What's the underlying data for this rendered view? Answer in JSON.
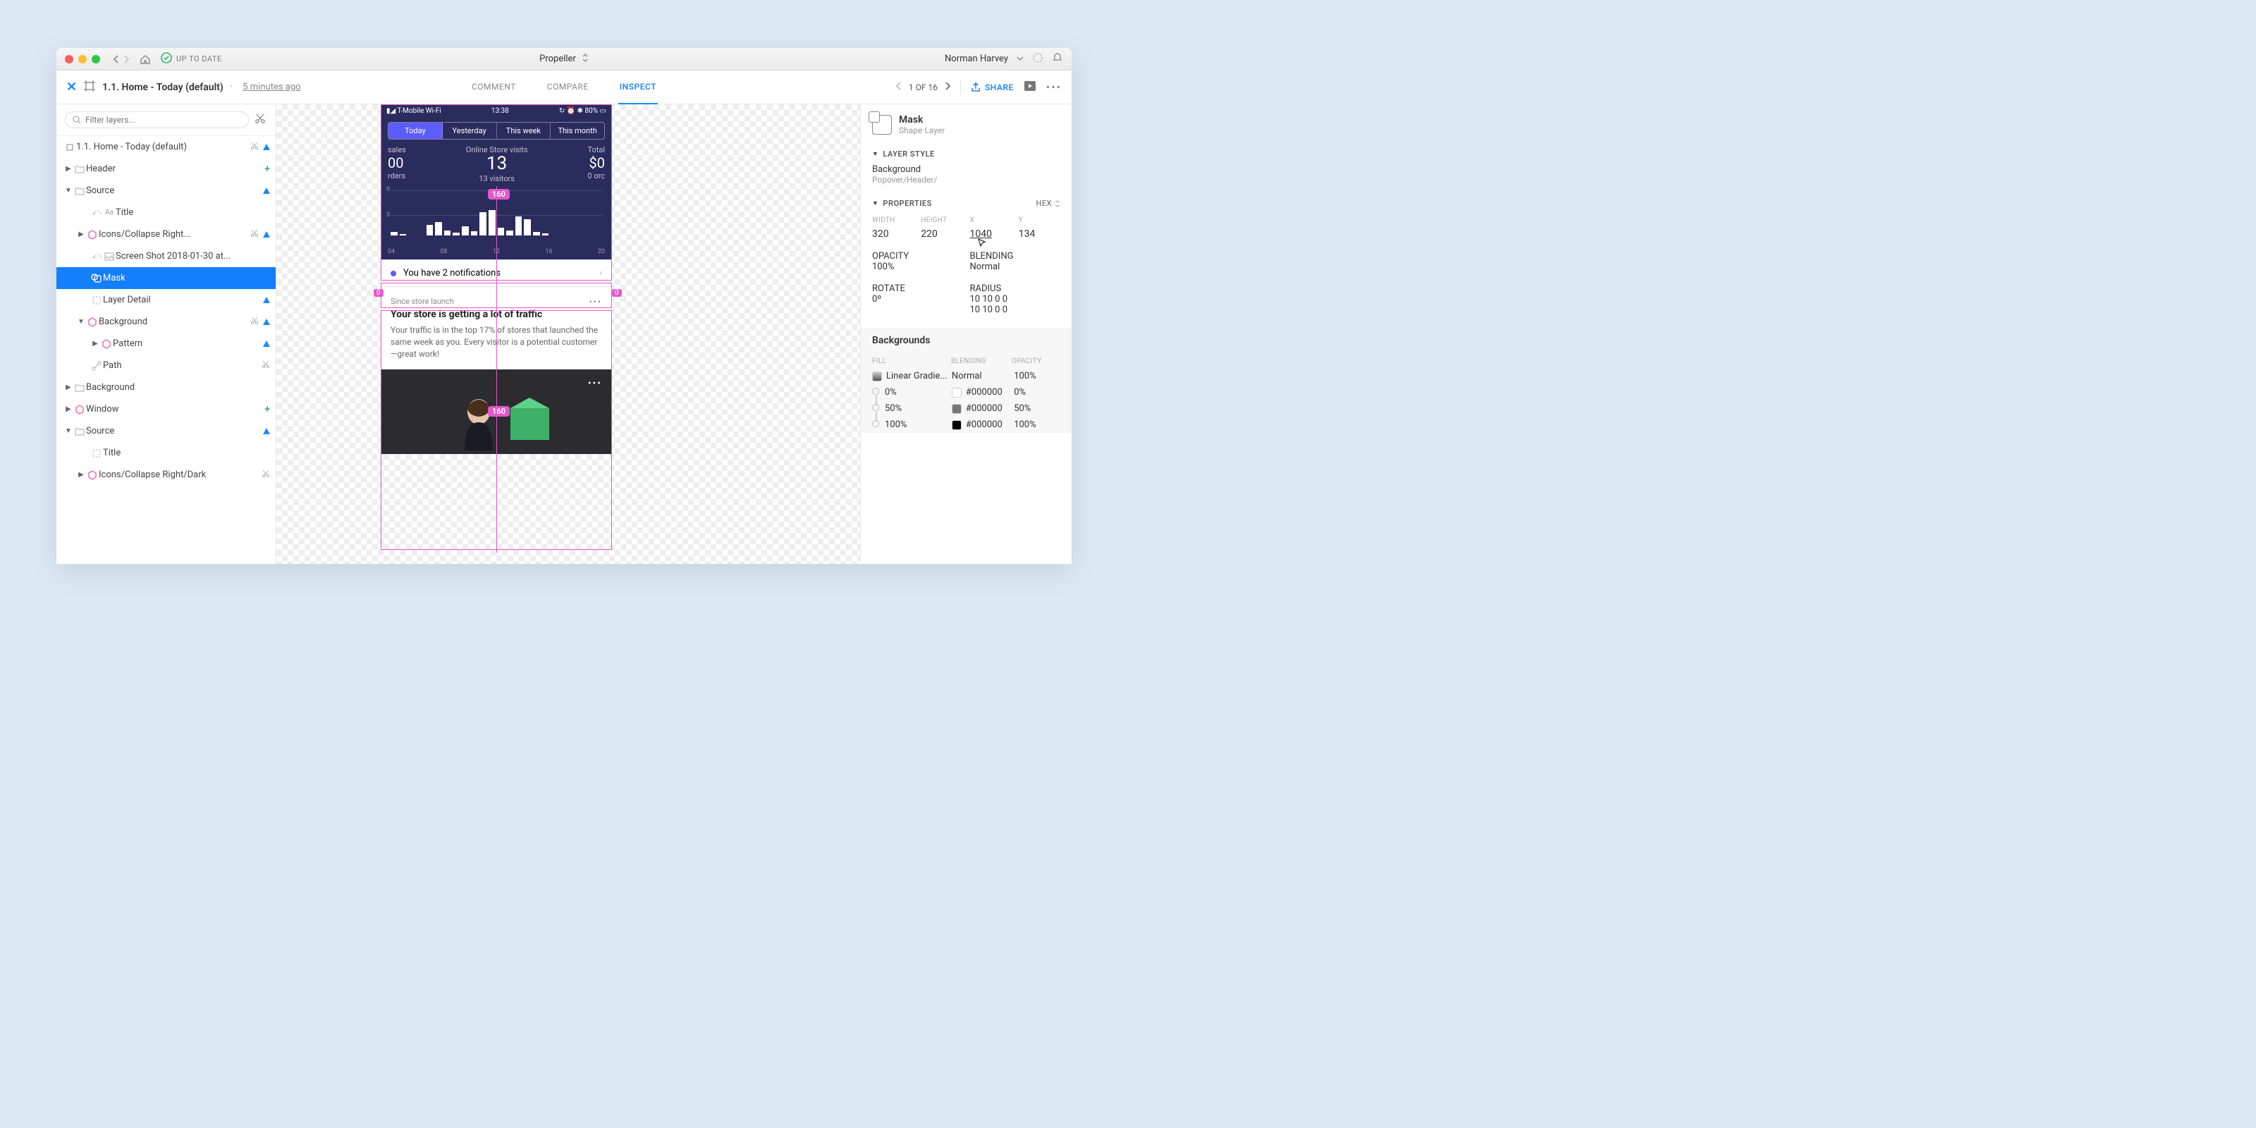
{
  "titlebar": {
    "status": "UP TO DATE",
    "project": "Propeller",
    "user": "Norman Harvey"
  },
  "toolbar": {
    "title": "1.1. Home - Today (default)",
    "time": "5 minutes ago",
    "tabs": {
      "comment": "COMMENT",
      "compare": "COMPARE",
      "inspect": "INSPECT"
    },
    "pager": "1 OF 16",
    "share": "SHARE"
  },
  "search": {
    "placeholder": "Filter layers..."
  },
  "tree": {
    "root": "1.1. Home - Today (default)",
    "header": "Header",
    "source": "Source",
    "title": "Title",
    "icons_collapse": "Icons/Collapse Right...",
    "screenshot": "Screen Shot 2018-01-30 at...",
    "mask": "Mask",
    "layer_detail": "Layer Detail",
    "background": "Background",
    "pattern": "Pattern",
    "path": "Path",
    "background2": "Background",
    "window": "Window",
    "source2": "Source",
    "title2": "Title",
    "icons_collapse2": "Icons/Collapse Right/Dark"
  },
  "phone": {
    "carrier": "T-Mobile Wi-Fi",
    "clock": "13:38",
    "battery": "80%",
    "seg": [
      "Today",
      "Yesterday",
      "This week",
      "This month"
    ],
    "left_metric_label": "sales",
    "left_metric_value": "00",
    "left_metric_sub": "rders",
    "center_label": "Online Store visits",
    "center_value": "13",
    "center_sub": "13 visitors",
    "right_label": "Total",
    "right_value": "$0",
    "right_sub": "0 orc",
    "ticks": [
      "04",
      "08",
      "12",
      "16",
      "20"
    ],
    "y9": "9",
    "y3": "3",
    "notif": "You have 2 notifications",
    "card_since": "Since store launch",
    "card_title": "Your store is getting a lot of traffic",
    "card_body": "Your traffic is in the top 17% of stores that launched the same week as you. Every visitor is a potential customer—great work!"
  },
  "measurements": {
    "w160a": "160",
    "w160b": "160",
    "zero": "0"
  },
  "right": {
    "name": "Mask",
    "type": "Shape Layer",
    "layerstyle_h": "LAYER STYLE",
    "ls_name": "Background",
    "ls_path": "Popover/Header/",
    "properties_h": "PROPERTIES",
    "hex": "HEX",
    "width_l": "WIDTH",
    "width_v": "320",
    "height_l": "HEIGHT",
    "height_v": "220",
    "x_l": "X",
    "x_v": "1040",
    "y_l": "Y",
    "y_v": "134",
    "opacity_l": "OPACITY",
    "opacity_v": "100%",
    "blending_l": "BLENDING",
    "blending_v": "Normal",
    "rotate_l": "ROTATE",
    "rotate_v": "0º",
    "radius_l": "RADIUS",
    "radius_old": "10 10 0 0",
    "radius_new": "10 10 0 0",
    "bg_h": "Backgrounds",
    "fill_l": "FILL",
    "blend_l": "BLENDING",
    "op_l": "OPACITY",
    "fill_v": "Linear Gradie...",
    "fill_blend": "Normal",
    "fill_op": "100%",
    "stop1_pct": "0%",
    "stop1_hex": "#000000",
    "stop1_op": "0%",
    "stop2_pct": "50%",
    "stop2_hex": "#000000",
    "stop2_op": "50%",
    "stop3_pct": "100%",
    "stop3_hex": "#000000",
    "stop3_op": "100%"
  }
}
